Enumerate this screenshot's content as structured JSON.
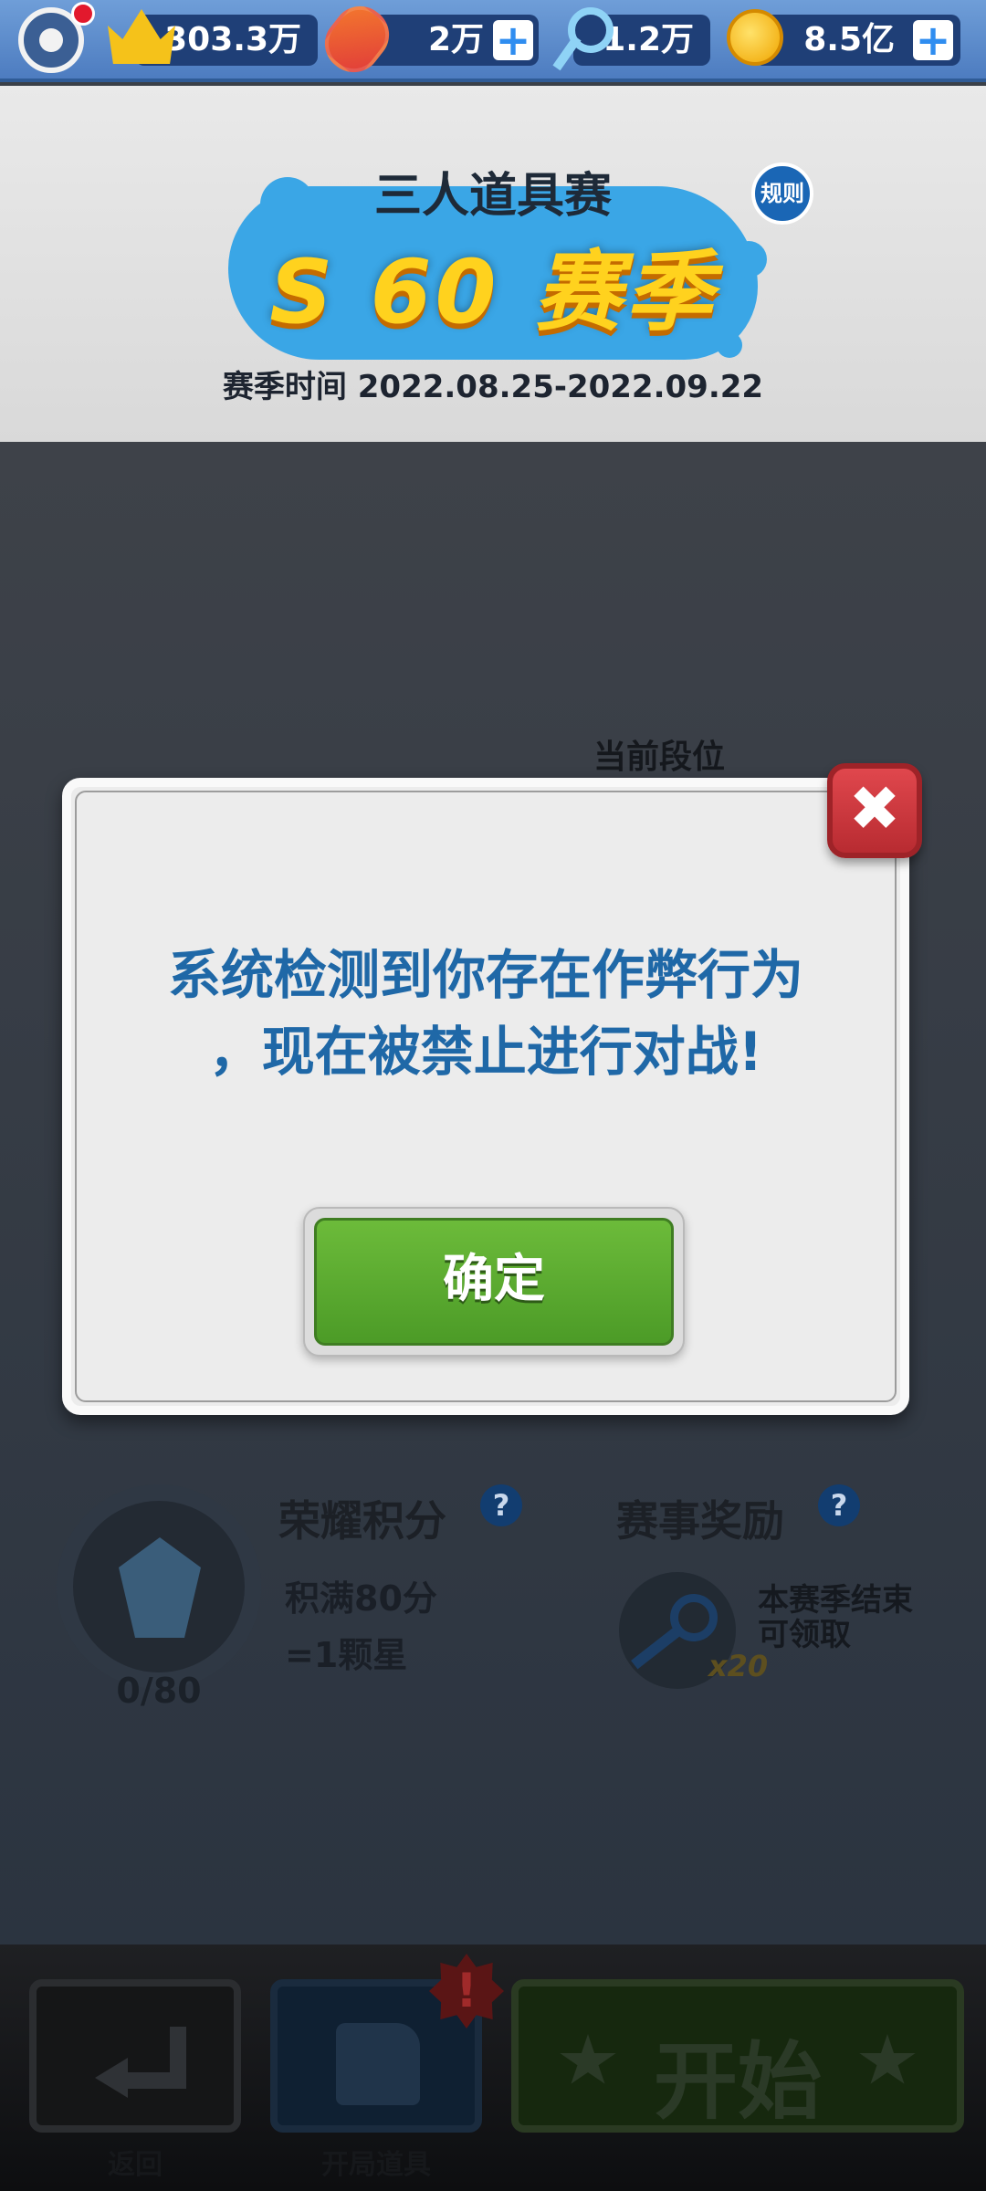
{
  "topbar": {
    "resources": [
      {
        "name": "crown",
        "icon": "crown-icon",
        "value": "303.3万"
      },
      {
        "name": "board",
        "icon": "hoverboard-icon",
        "value": "2万"
      },
      {
        "name": "key",
        "icon": "key-icon",
        "value": "1.2万"
      },
      {
        "name": "coin",
        "icon": "coin-icon",
        "value": "8.5亿"
      }
    ],
    "plus_glyph": "+"
  },
  "header": {
    "event_title": "三人道具赛",
    "season_label": "S 60 赛季",
    "season_time": "赛季时间 2022.08.25-2022.09.22",
    "rules_label": "规则"
  },
  "background": {
    "rank_title": "当前段位",
    "glory_title": "荣耀积分",
    "glory_desc_line1": "积满80分",
    "glory_desc_line2": "=1颗星",
    "score": "0/80",
    "reward_title": "赛事奖励",
    "reward_qty": "x20",
    "reward_desc_line1": "本赛季结束",
    "reward_desc_line2": "可领取",
    "help_glyph": "?"
  },
  "modal": {
    "message_line1": "系统检测到你存在作弊行为",
    "message_line2": "，现在被禁止进行对战!",
    "confirm_label": "确定",
    "close_glyph": "✖"
  },
  "bottombar": {
    "back_label": "返回",
    "props_label": "开局道具",
    "start_label": "开始",
    "alert_glyph": "!"
  },
  "colors": {
    "modal_text": "#1f68a7",
    "confirm_green": "#4c9b27",
    "close_red": "#c8353b"
  }
}
